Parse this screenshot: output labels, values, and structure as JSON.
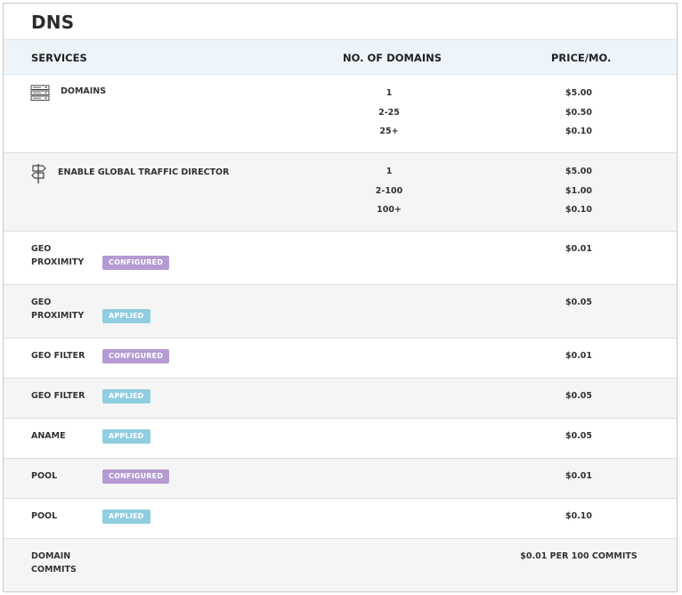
{
  "title": "DNS",
  "headers": {
    "services": "SERVICES",
    "domains": "NO. OF DOMAINS",
    "price": "PRICE/MO."
  },
  "domains_row": {
    "label": "DOMAINS",
    "icon": "server-stack-icon",
    "counts": [
      "1",
      "2-25",
      "25+"
    ],
    "prices": [
      "$5.00",
      "$0.50",
      "$0.10"
    ]
  },
  "gtd_row": {
    "label": "ENABLE GLOBAL TRAFFIC DIRECTOR",
    "icon": "signpost-icon",
    "counts": [
      "1",
      "2-100",
      "100+"
    ],
    "prices": [
      "$5.00",
      "$1.00",
      "$0.10"
    ]
  },
  "rows": [
    {
      "line1": "GEO",
      "line2": "PROXIMITY",
      "badge": "CONFIGURED",
      "badge_kind": "configured",
      "price": "$0.01"
    },
    {
      "line1": "GEO",
      "line2": "PROXIMITY",
      "badge": "APPLIED",
      "badge_kind": "applied",
      "price": "$0.05"
    },
    {
      "line1": "GEO FILTER",
      "badge": "CONFIGURED",
      "badge_kind": "configured",
      "price": "$0.01"
    },
    {
      "line1": "GEO FILTER",
      "badge": "APPLIED",
      "badge_kind": "applied",
      "price": "$0.05"
    },
    {
      "line1": "ANAME",
      "badge": "APPLIED",
      "badge_kind": "applied",
      "price": "$0.05"
    },
    {
      "line1": "POOL",
      "badge": "CONFIGURED",
      "badge_kind": "configured",
      "price": "$0.01"
    },
    {
      "line1": "POOL",
      "badge": "APPLIED",
      "badge_kind": "applied",
      "price": "$0.10"
    }
  ],
  "commits_row": {
    "line1": "DOMAIN",
    "line2": "COMMITS",
    "price": "$0.01 PER 100 COMMITS"
  },
  "colors": {
    "header_bg": "#eef5fa",
    "configured_badge": "#b49bd2",
    "applied_badge": "#8fcde0",
    "alt_row": "#f5f5f5"
  }
}
